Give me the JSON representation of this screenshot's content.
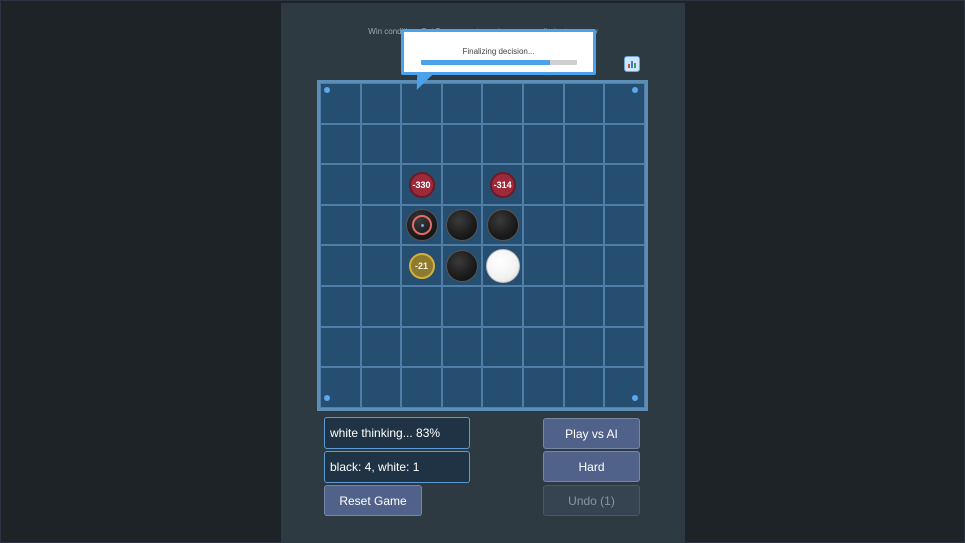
{
  "header": {
    "win_condition": "Win condition: Get 5 or more stones in a row, or eliminate enemy",
    "subtitle": ""
  },
  "icons": {
    "stats": "bar-chart-icon"
  },
  "popup": {
    "text": "Finalizing decision...",
    "progress": 0.83
  },
  "board": {
    "size": 8,
    "stones": [
      {
        "row": 3,
        "col": 2,
        "color": "black",
        "last_move": true
      },
      {
        "row": 3,
        "col": 3,
        "color": "black",
        "last_move": false
      },
      {
        "row": 3,
        "col": 4,
        "color": "black",
        "last_move": false
      },
      {
        "row": 4,
        "col": 3,
        "color": "black",
        "last_move": false
      },
      {
        "row": 4,
        "col": 4,
        "color": "white",
        "last_move": false
      }
    ],
    "scores": [
      {
        "row": 2,
        "col": 2,
        "label": "-330",
        "tone": "red"
      },
      {
        "row": 2,
        "col": 4,
        "label": "-314",
        "tone": "red"
      },
      {
        "row": 4,
        "col": 2,
        "label": "-21",
        "tone": "gold"
      }
    ]
  },
  "status": {
    "thinking": "white thinking... 83%",
    "counts": "black: 4, white: 1"
  },
  "buttons": {
    "play_vs_ai": "Play vs AI",
    "difficulty": "Hard",
    "reset": "Reset Game",
    "undo": "Undo (1)"
  },
  "colors": {
    "board": "#264e70",
    "grid": "#4f7ea8",
    "accent": "#4aa3ea",
    "score_bad": "#9c2a3a",
    "score_best": "#d3b13b"
  }
}
